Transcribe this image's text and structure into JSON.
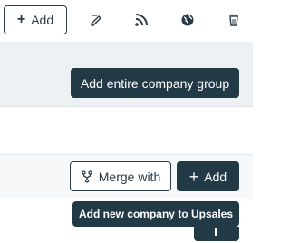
{
  "toolbar": {
    "add_label": "Add",
    "icons": [
      "edit-icon",
      "rss-icon",
      "globe-icon",
      "trash-icon"
    ]
  },
  "tooltips": {
    "add_group": "Add entire company group",
    "add_company": "Add new company to Upsales"
  },
  "actions": {
    "merge_label": "Merge with",
    "add_label": "Add"
  },
  "colors": {
    "dark": "#213a45",
    "outline": "#2b3a45",
    "band_grey": "#eef1f4"
  }
}
